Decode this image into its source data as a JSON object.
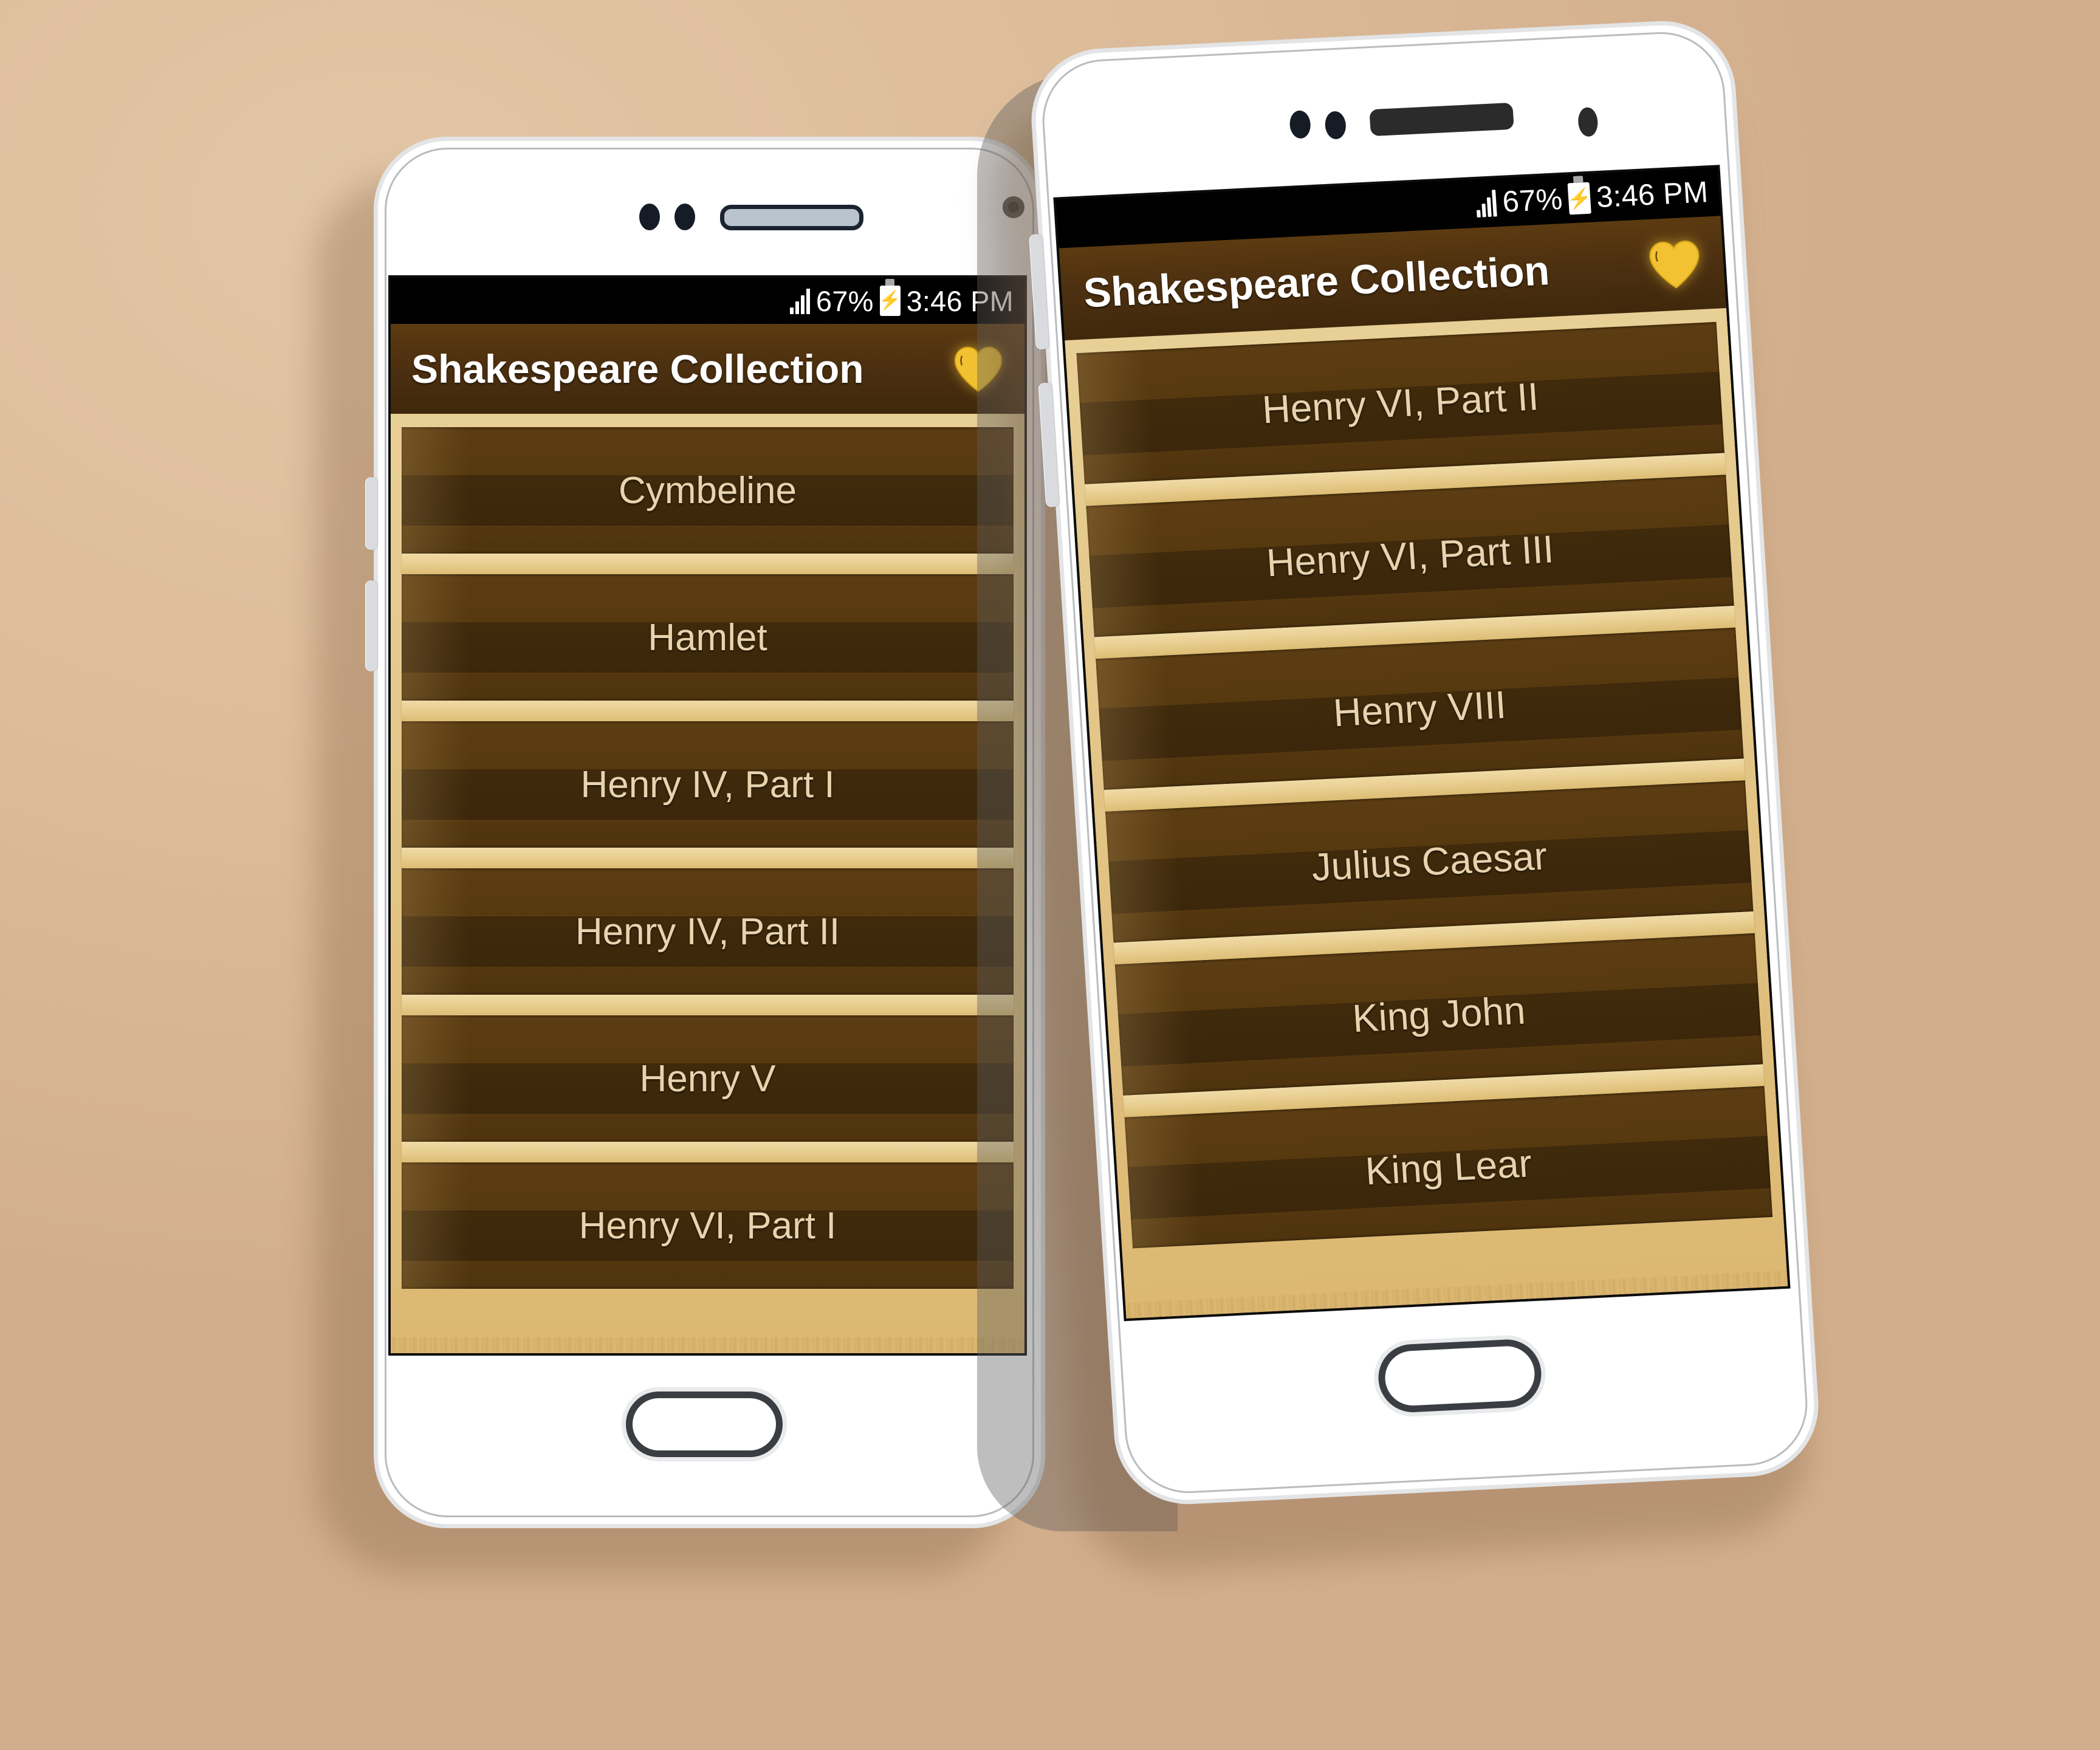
{
  "background_color": "#dcbb99",
  "theme": {
    "appbar_brown": "#4d3010",
    "row_brown": "#4e330e",
    "parchment_gold": "#e2c485",
    "divider_gold": "#e8cd8f",
    "row_text": "#e8d3ae",
    "heart_yellow": "#f2c232",
    "phone_white": "#ffffff",
    "statusbar_black": "#000000"
  },
  "status_bar": {
    "signal_icon": "signal-bars-icon",
    "battery_percent": "67%",
    "battery_icon": "battery-charging-icon",
    "battery_bolt": "⚡",
    "time": "3:46 PM"
  },
  "app_bar": {
    "title": "Shakespeare Collection",
    "favorite_icon": "heart-icon"
  },
  "phones": [
    {
      "id": "phone-left",
      "label": "Left phone",
      "hardware": {
        "sensor_dots": 2,
        "speaker_icon": "speaker-grille-icon",
        "camera_icon": "front-camera-icon",
        "home_button_icon": "home-button-icon"
      },
      "list_items": [
        "Cymbeline",
        "Hamlet",
        "Henry IV, Part I",
        "Henry IV, Part II",
        "Henry V",
        "Henry VI, Part I"
      ]
    },
    {
      "id": "phone-right",
      "label": "Right phone",
      "hardware": {
        "sensor_dots": 2,
        "speaker_icon": "speaker-grille-icon",
        "camera_icon": "front-camera-icon",
        "home_button_icon": "home-button-icon",
        "side_buttons": [
          "volume-button",
          "power-button"
        ]
      },
      "list_items": [
        "Henry VI, Part II",
        "Henry VI, Part III",
        "Henry VIII",
        "Julius Caesar",
        "King John",
        "King Lear"
      ]
    }
  ]
}
